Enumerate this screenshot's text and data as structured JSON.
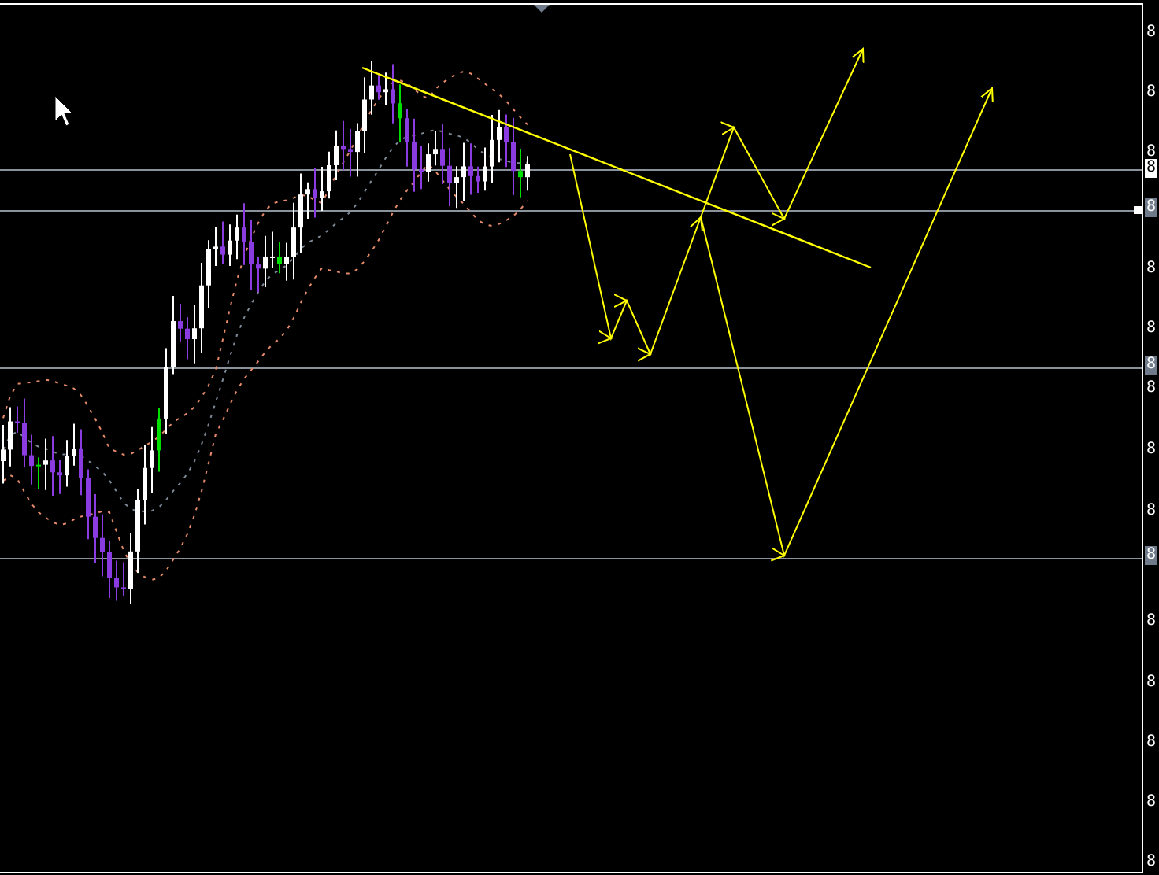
{
  "price_axis": {
    "labels": [
      {
        "text": "8"
      },
      {
        "text": "8"
      },
      {
        "text": "8"
      },
      {
        "text": "8"
      },
      {
        "text": "8"
      },
      {
        "text": "8"
      },
      {
        "text": "8"
      },
      {
        "text": "8"
      },
      {
        "text": "8"
      },
      {
        "text": "8"
      },
      {
        "text": "8"
      },
      {
        "text": "8"
      },
      {
        "text": "8"
      }
    ]
  },
  "price_tags": [
    {
      "kind": "current",
      "text": "8"
    },
    {
      "kind": "level",
      "text": "8"
    },
    {
      "kind": "level",
      "text": "8"
    },
    {
      "kind": "level",
      "text": "8"
    }
  ]
}
